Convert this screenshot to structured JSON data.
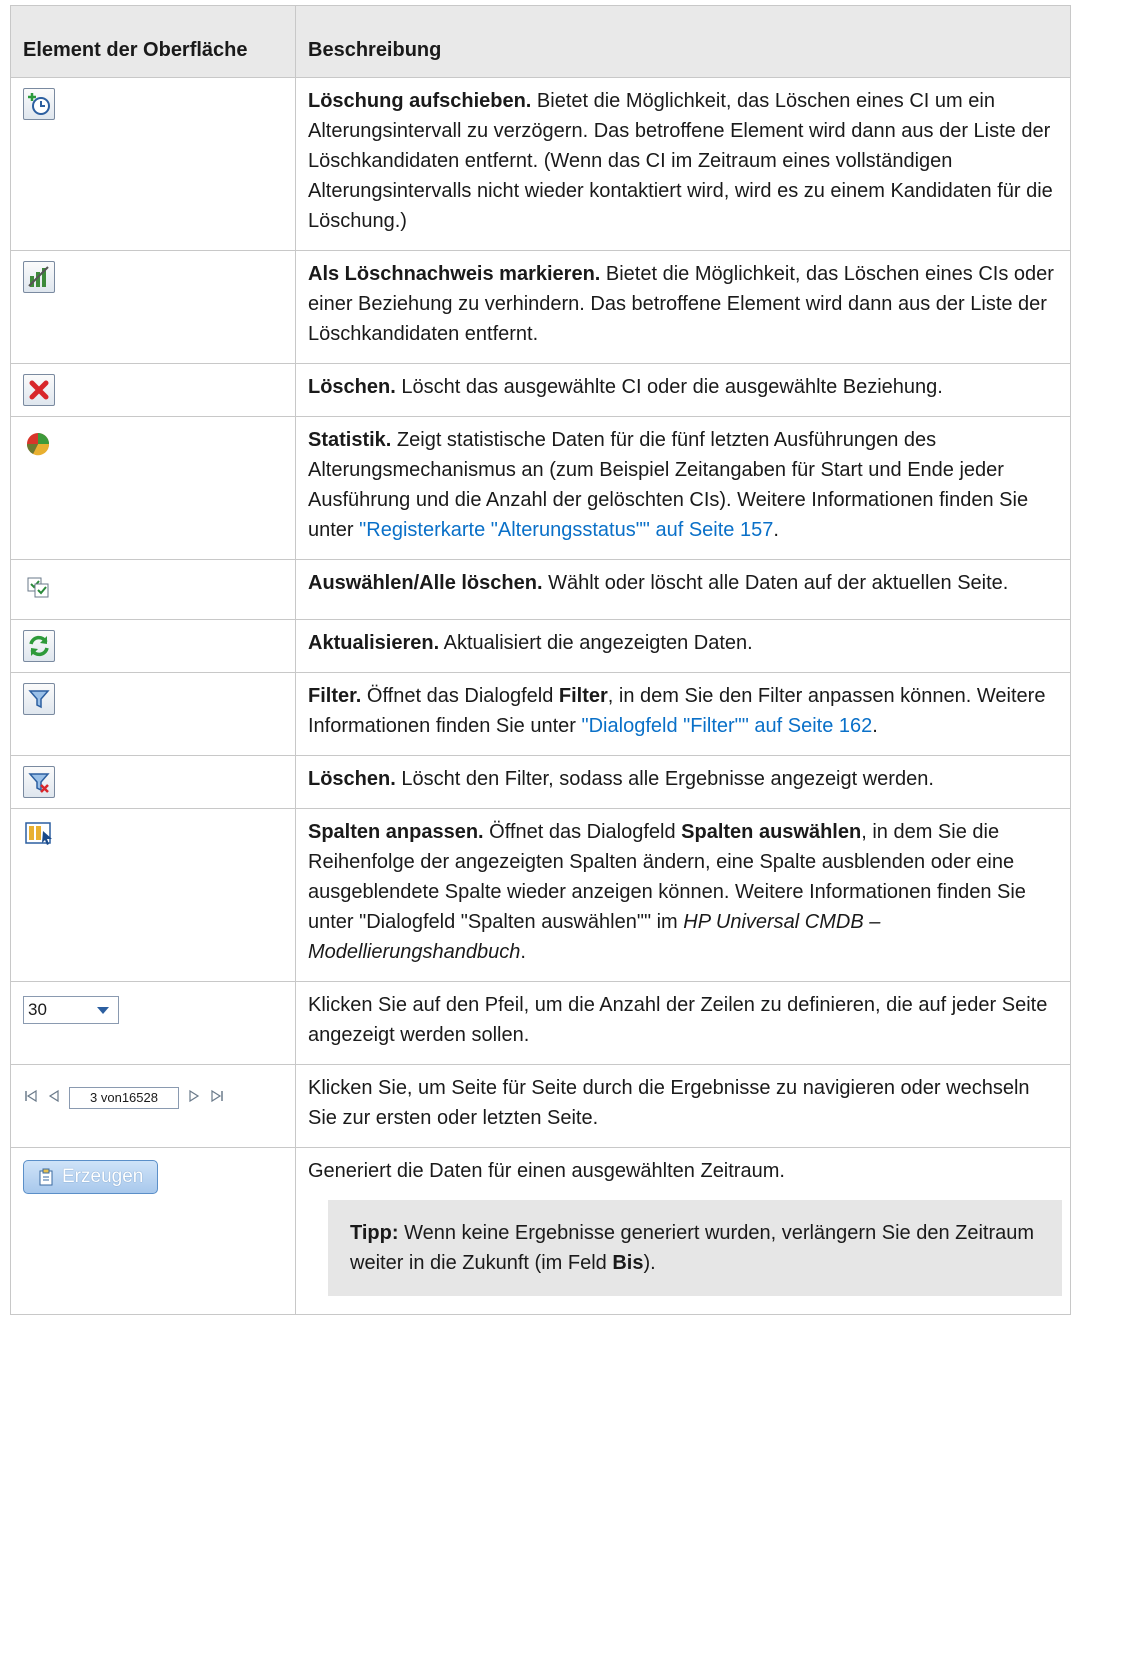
{
  "header": {
    "col1": "Element der Oberfläche",
    "col2": "Beschreibung"
  },
  "rows": [
    {
      "icon": "postpone-deletion-icon",
      "bold": "Löschung aufschieben.",
      "text": " Bietet die Möglichkeit, das Löschen eines CI um ein Alterungsintervall zu verzögern. Das betroffene Element wird dann aus der Liste der Löschkandidaten entfernt. (Wenn das CI im Zeitraum eines vollständigen Alterungsintervalls nicht wieder kontaktiert wird, wird es zu einem Kandidaten für die Löschung.)"
    },
    {
      "icon": "mark-as-deletion-proof-icon",
      "bold": "Als Löschnachweis markieren.",
      "text": " Bietet die Möglichkeit, das Löschen eines CIs oder einer Beziehung zu verhindern. Das betroffene Element wird dann aus der Liste der Löschkandidaten entfernt."
    },
    {
      "icon": "delete-icon",
      "bold": "Löschen.",
      "text": " Löscht das ausgewählte CI oder die ausgewählte Beziehung."
    },
    {
      "icon": "statistics-icon",
      "bold": "Statistik.",
      "text": " Zeigt statistische Daten für die fünf letzten Ausführungen des Alterungsmechanismus an (zum Beispiel Zeitangaben für Start und Ende jeder Ausführung und die Anzahl der gelöschten CIs). Weitere Informationen finden Sie unter ",
      "link": "\"Registerkarte \"Alterungsstatus\"\" auf Seite 157",
      "after": "."
    },
    {
      "icon": "select-clear-all-icon",
      "bold": "Auswählen/Alle löschen.",
      "text": " Wählt oder löscht alle Daten auf der aktuellen Seite."
    },
    {
      "icon": "refresh-icon",
      "bold": "Aktualisieren.",
      "text": " Aktualisiert die angezeigten Daten."
    },
    {
      "icon": "filter-icon",
      "bold": "Filter.",
      "text1": " Öffnet das Dialogfeld ",
      "bold2": "Filter",
      "text2": ", in dem Sie den Filter anpassen können. Weitere Informationen finden Sie unter ",
      "link": "\"Dialogfeld \"Filter\"\" auf Seite 162",
      "after": "."
    },
    {
      "icon": "clear-filter-icon",
      "bold": "Löschen.",
      "text": " Löscht den Filter, sodass alle Ergebnisse angezeigt werden."
    },
    {
      "icon": "customize-columns-icon",
      "bold": "Spalten anpassen.",
      "text1": " Öffnet das Dialogfeld ",
      "bold2": "Spalten auswählen",
      "text2": ", in dem Sie die Reihenfolge der angezeigten Spalten ändern, eine Spalte ausblenden oder eine ausgeblendete Spalte wieder anzeigen können. Weitere Informationen finden Sie unter \"Dialogfeld \"Spalten auswählen\"\" im ",
      "italic": "HP Universal CMDB – Modellierungshandbuch",
      "after": "."
    },
    {
      "dropdown_value": "30",
      "text": "Klicken Sie auf den Pfeil, um die Anzahl der Zeilen zu definieren, die auf jeder Seite angezeigt werden sollen."
    },
    {
      "pager_value": "3 von16528",
      "text": "Klicken Sie, um Seite für Seite durch die Ergebnisse zu navigieren oder wechseln Sie zur ersten oder letzten Seite."
    },
    {
      "button_label": "Erzeugen",
      "text": "Generiert die Daten für einen ausgewählten Zeitraum.",
      "tip_label": "Tipp:",
      "tip_text": " Wenn keine Ergebnisse generiert wurden, verlängern Sie den Zeitraum weiter in die Zukunft (im Feld ",
      "tip_bold": "Bis",
      "tip_after": ")."
    }
  ]
}
